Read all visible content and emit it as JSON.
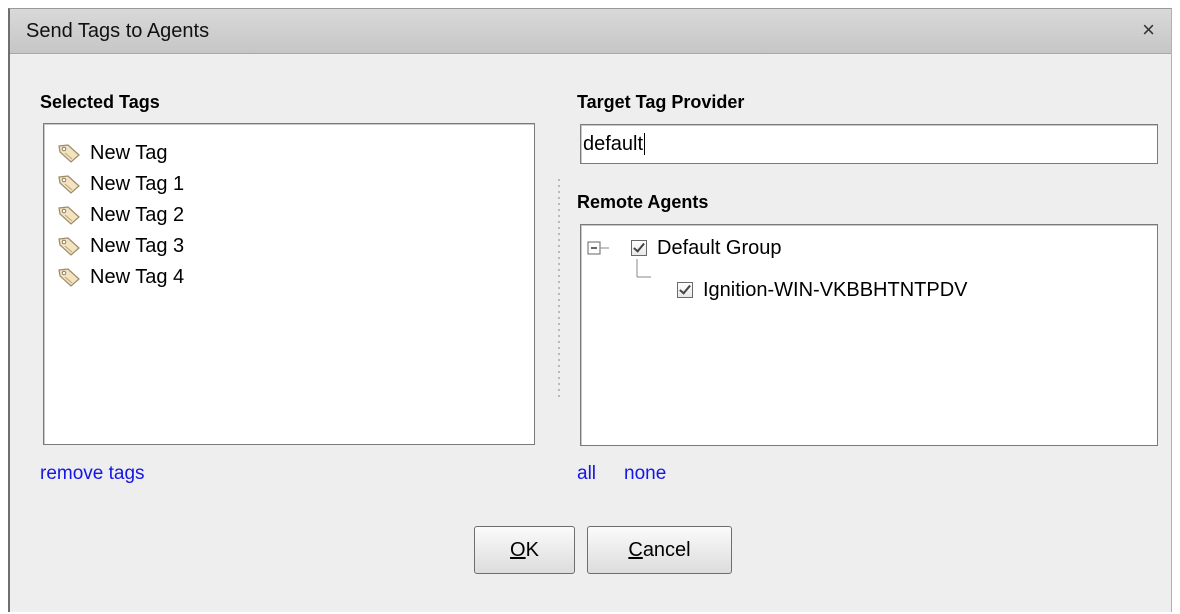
{
  "dialog": {
    "title": "Send Tags to Agents",
    "close_glyph": "×"
  },
  "selected_tags": {
    "label": "Selected Tags",
    "items": [
      "New Tag",
      "New Tag 1",
      "New Tag 2",
      "New Tag 3",
      "New Tag 4"
    ],
    "icon": "tag-icon",
    "remove_link": "remove tags"
  },
  "target_provider": {
    "label": "Target Tag Provider",
    "value": "default"
  },
  "remote_agents": {
    "label": "Remote Agents",
    "tree": {
      "group": {
        "label": "Default Group",
        "checked": true,
        "expanded": true
      },
      "child": {
        "label": "Ignition-WIN-VKBBHTNTPDV",
        "checked": true
      }
    },
    "link_all": "all",
    "link_none": "none"
  },
  "buttons": {
    "ok_mnemonic": "O",
    "ok_rest": "K",
    "cancel_mnemonic": "C",
    "cancel_rest": "ancel"
  },
  "colors": {
    "link": "#1515e6",
    "titlebar": "#cfcfcf",
    "dialog_bg": "#eeeeee"
  }
}
